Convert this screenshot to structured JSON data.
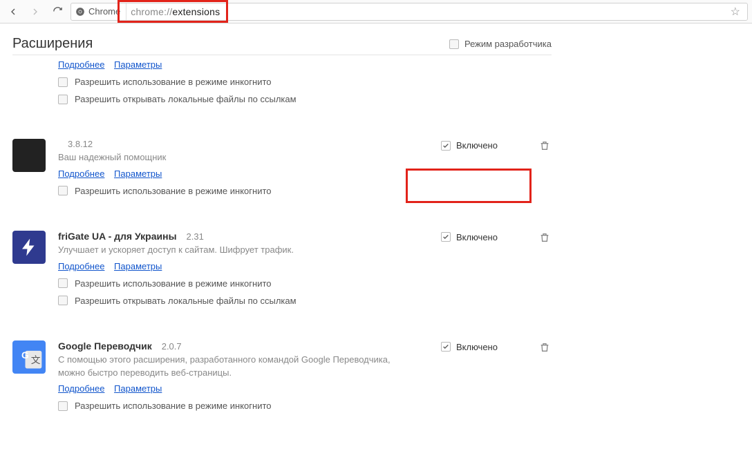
{
  "toolbar": {
    "chip_label": "Chrome",
    "url_scheme": "chrome://",
    "url_path": "extensions"
  },
  "header": {
    "title": "Расширения",
    "dev_mode_label": "Режим разработчика"
  },
  "common": {
    "details": "Подробнее",
    "options": "Параметры",
    "enabled": "Включено",
    "allow_incognito": "Разрешить использование в режиме инкогнито",
    "allow_file_urls": "Разрешить открывать локальные файлы по ссылкам"
  },
  "ext_top": {
    "show_file_urls": true
  },
  "ext1": {
    "name": "",
    "version": "3.8.12",
    "desc": "Ваш надежный помощник"
  },
  "ext2": {
    "name": "friGate UA - для Украины",
    "version": "2.31",
    "desc": "Улучшает и ускоряет доступ к сайтам. Шифрует трафик."
  },
  "ext3": {
    "name": "Google Переводчик",
    "version": "2.0.7",
    "desc": "С помощью этого расширения, разработанного командой Google Переводчика, можно быстро переводить веб-страницы."
  }
}
